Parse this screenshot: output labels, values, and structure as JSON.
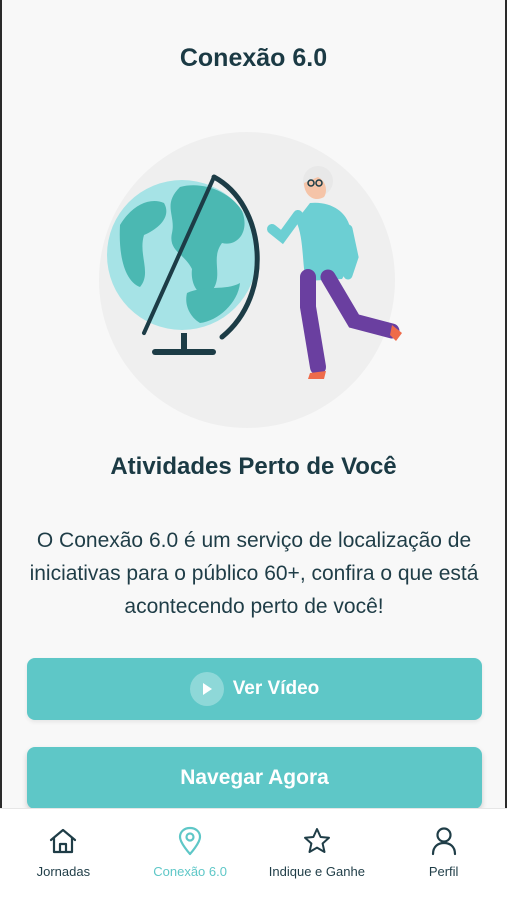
{
  "header": {
    "title": "Conexão 6.0"
  },
  "main": {
    "section_title": "Atividades Perto de Você",
    "description": "O Conexão 6.0 é um serviço de localização de iniciativas para o público 60+, confira o que está acontecendo perto de você!",
    "video_button_label": "Ver Vídeo",
    "navigate_button_label": "Navegar Agora"
  },
  "tabbar": {
    "active_index": 1,
    "items": [
      {
        "label": "Jornadas",
        "icon": "home-icon"
      },
      {
        "label": "Conexão 6.0",
        "icon": "location-pin-icon"
      },
      {
        "label": "Indique e Ganhe",
        "icon": "star-icon"
      },
      {
        "label": "Perfil",
        "icon": "user-icon"
      }
    ]
  },
  "colors": {
    "accent": "#5ec7c7",
    "title": "#1b3a44",
    "background": "#f8f8f8"
  }
}
